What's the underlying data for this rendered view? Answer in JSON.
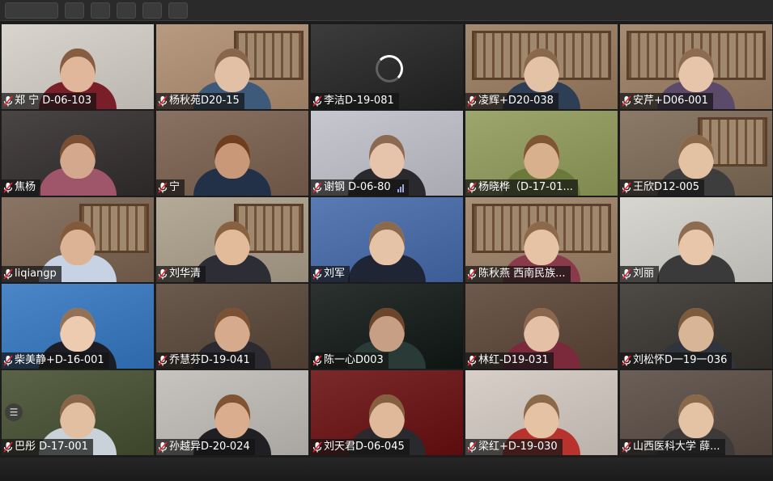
{
  "toolbar": {
    "buttons": [
      "",
      "",
      "",
      "",
      "",
      ""
    ]
  },
  "participants": [
    {
      "name": "郑 宁 D-06-103",
      "bg": "#d9d4ce",
      "head": "#e0b79a",
      "shirt": "#7a1f2a"
    },
    {
      "name": "杨秋苑D20-15",
      "bg": "#b89a80",
      "head": "#e2c0a5",
      "shirt": "#3d5a7a"
    },
    {
      "name": "李洁D-19-081",
      "bg": "#3c3c3c",
      "loading": true
    },
    {
      "name": "凌辉+D20-038",
      "bg": "#a58a72",
      "head": "#e4c2a6",
      "shirt": "#2e3e55"
    },
    {
      "name": "安芹+D06-001",
      "bg": "#a68c74",
      "head": "#e6c5aa",
      "shirt": "#5b4a6a"
    },
    {
      "name": "焦杨",
      "bg": "#4a4545",
      "head": "#d4a88c",
      "shirt": "#a0566a"
    },
    {
      "name": "宁",
      "bg": "#8a7262",
      "head": "#c99878",
      "shirt": "#233148"
    },
    {
      "name": "谢钢  D-06-80",
      "bg": "#c7c7cf",
      "head": "#e5c4ab",
      "shirt": "#2a2a2e",
      "signal": true
    },
    {
      "name": "杨晓桦（D-17-01...",
      "bg": "#9da66c",
      "head": "#d8b08e",
      "shirt": "#6b7a3a"
    },
    {
      "name": "王欣D12-005",
      "bg": "#8c7a69",
      "head": "#e3c1a3",
      "shirt": "#3d3d3d"
    },
    {
      "name": "liqiangp",
      "bg": "#8a7464",
      "head": "#dcb394",
      "shirt": "#c7d3e4"
    },
    {
      "name": "刘华清",
      "bg": "#b5aa98",
      "head": "#e2bb9a",
      "shirt": "#2d2d36"
    },
    {
      "name": "刘军",
      "bg": "#5a7ab4",
      "head": "#e5c3a6",
      "shirt": "#1f2535"
    },
    {
      "name": "陈秋燕 西南民族...",
      "bg": "#a88f77",
      "head": "#e6c3a4",
      "shirt": "#8a3a4a"
    },
    {
      "name": "刘丽",
      "bg": "#d8d6d0",
      "head": "#e8c6aa",
      "shirt": "#3a3a3a"
    },
    {
      "name": "柴美静+D-16-001",
      "bg": "#4a86c8",
      "head": "#eccbb0",
      "shirt": "#1d1d26"
    },
    {
      "name": "乔慧芬D-19-041",
      "bg": "#6b5a4e",
      "head": "#d6aa8c",
      "shirt": "#2a2a30"
    },
    {
      "name": "陈一心D003",
      "bg": "#2c3230",
      "head": "#c79f84",
      "shirt": "#2a3a36"
    },
    {
      "name": "林红-D19-031",
      "bg": "#6e5a4d",
      "head": "#e4c1a6",
      "shirt": "#7a2a3a"
    },
    {
      "name": "刘松怀D一19一036",
      "bg": "#4e4a46",
      "head": "#d9b597",
      "shirt": "#30343c"
    },
    {
      "name": "巴彤 D-17-001",
      "bg": "#5a6248",
      "head": "#e2bfa1",
      "shirt": "#c9d2d8"
    },
    {
      "name": "孙越异D-20-024",
      "bg": "#c7c4bf",
      "head": "#d9ad8e",
      "shirt": "#1f1f24"
    },
    {
      "name": "刘天君D-06-045",
      "bg": "#7a2a2a",
      "head": "#e0b99a",
      "shirt": "#2a2a2e"
    },
    {
      "name": "梁红+D-19-030",
      "bg": "#d8d0c8",
      "head": "#e6c2a4",
      "shirt": "#b8332e"
    },
    {
      "name": "山西医科大学 薛...",
      "bg": "#6b5f58",
      "head": "#e4c2a4",
      "shirt": "#3e3a3a"
    }
  ],
  "side_button": "☰"
}
